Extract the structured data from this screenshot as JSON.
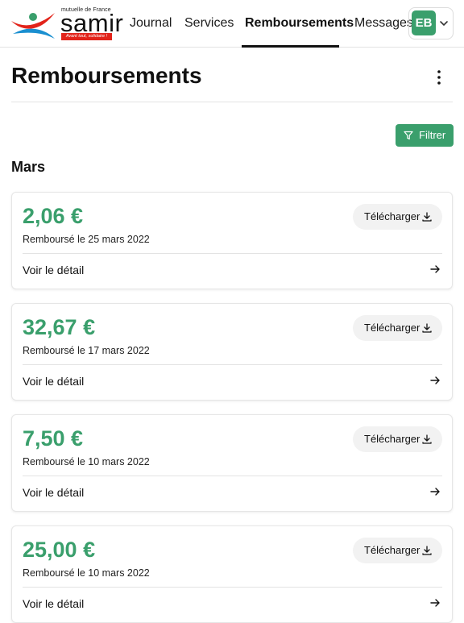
{
  "brand": {
    "tagline_top": "mutuelle de France",
    "wordmark": "samir",
    "slogan": "Avant tout, solidaire !",
    "colors": {
      "red": "#e2231a",
      "blue": "#1a8fd0",
      "green": "#3a9f6c"
    }
  },
  "nav": {
    "items": [
      {
        "label": "Journal",
        "active": false
      },
      {
        "label": "Services",
        "active": false
      },
      {
        "label": "Remboursements",
        "active": true
      },
      {
        "label": "Messages",
        "active": false
      }
    ],
    "avatar_initials": "EB",
    "avatar_icon": "chevron-down-icon"
  },
  "page": {
    "title": "Remboursements",
    "menu_icon": "more-vertical-icon",
    "filter_label": "Filtrer",
    "filter_icon": "filter-icon",
    "month": "Mars"
  },
  "reimbursements": [
    {
      "amount": "2,06 €",
      "date": "Remboursé le 25 mars 2022",
      "download_label": "Télécharger",
      "detail_label": "Voir le détail"
    },
    {
      "amount": "32,67 €",
      "date": "Remboursé le 17 mars 2022",
      "download_label": "Télécharger",
      "detail_label": "Voir le détail"
    },
    {
      "amount": "7,50 €",
      "date": "Remboursé le 10 mars 2022",
      "download_label": "Télécharger",
      "detail_label": "Voir le détail"
    },
    {
      "amount": "25,00 €",
      "date": "Remboursé le 10 mars 2022",
      "download_label": "Télécharger",
      "detail_label": "Voir le détail"
    }
  ]
}
